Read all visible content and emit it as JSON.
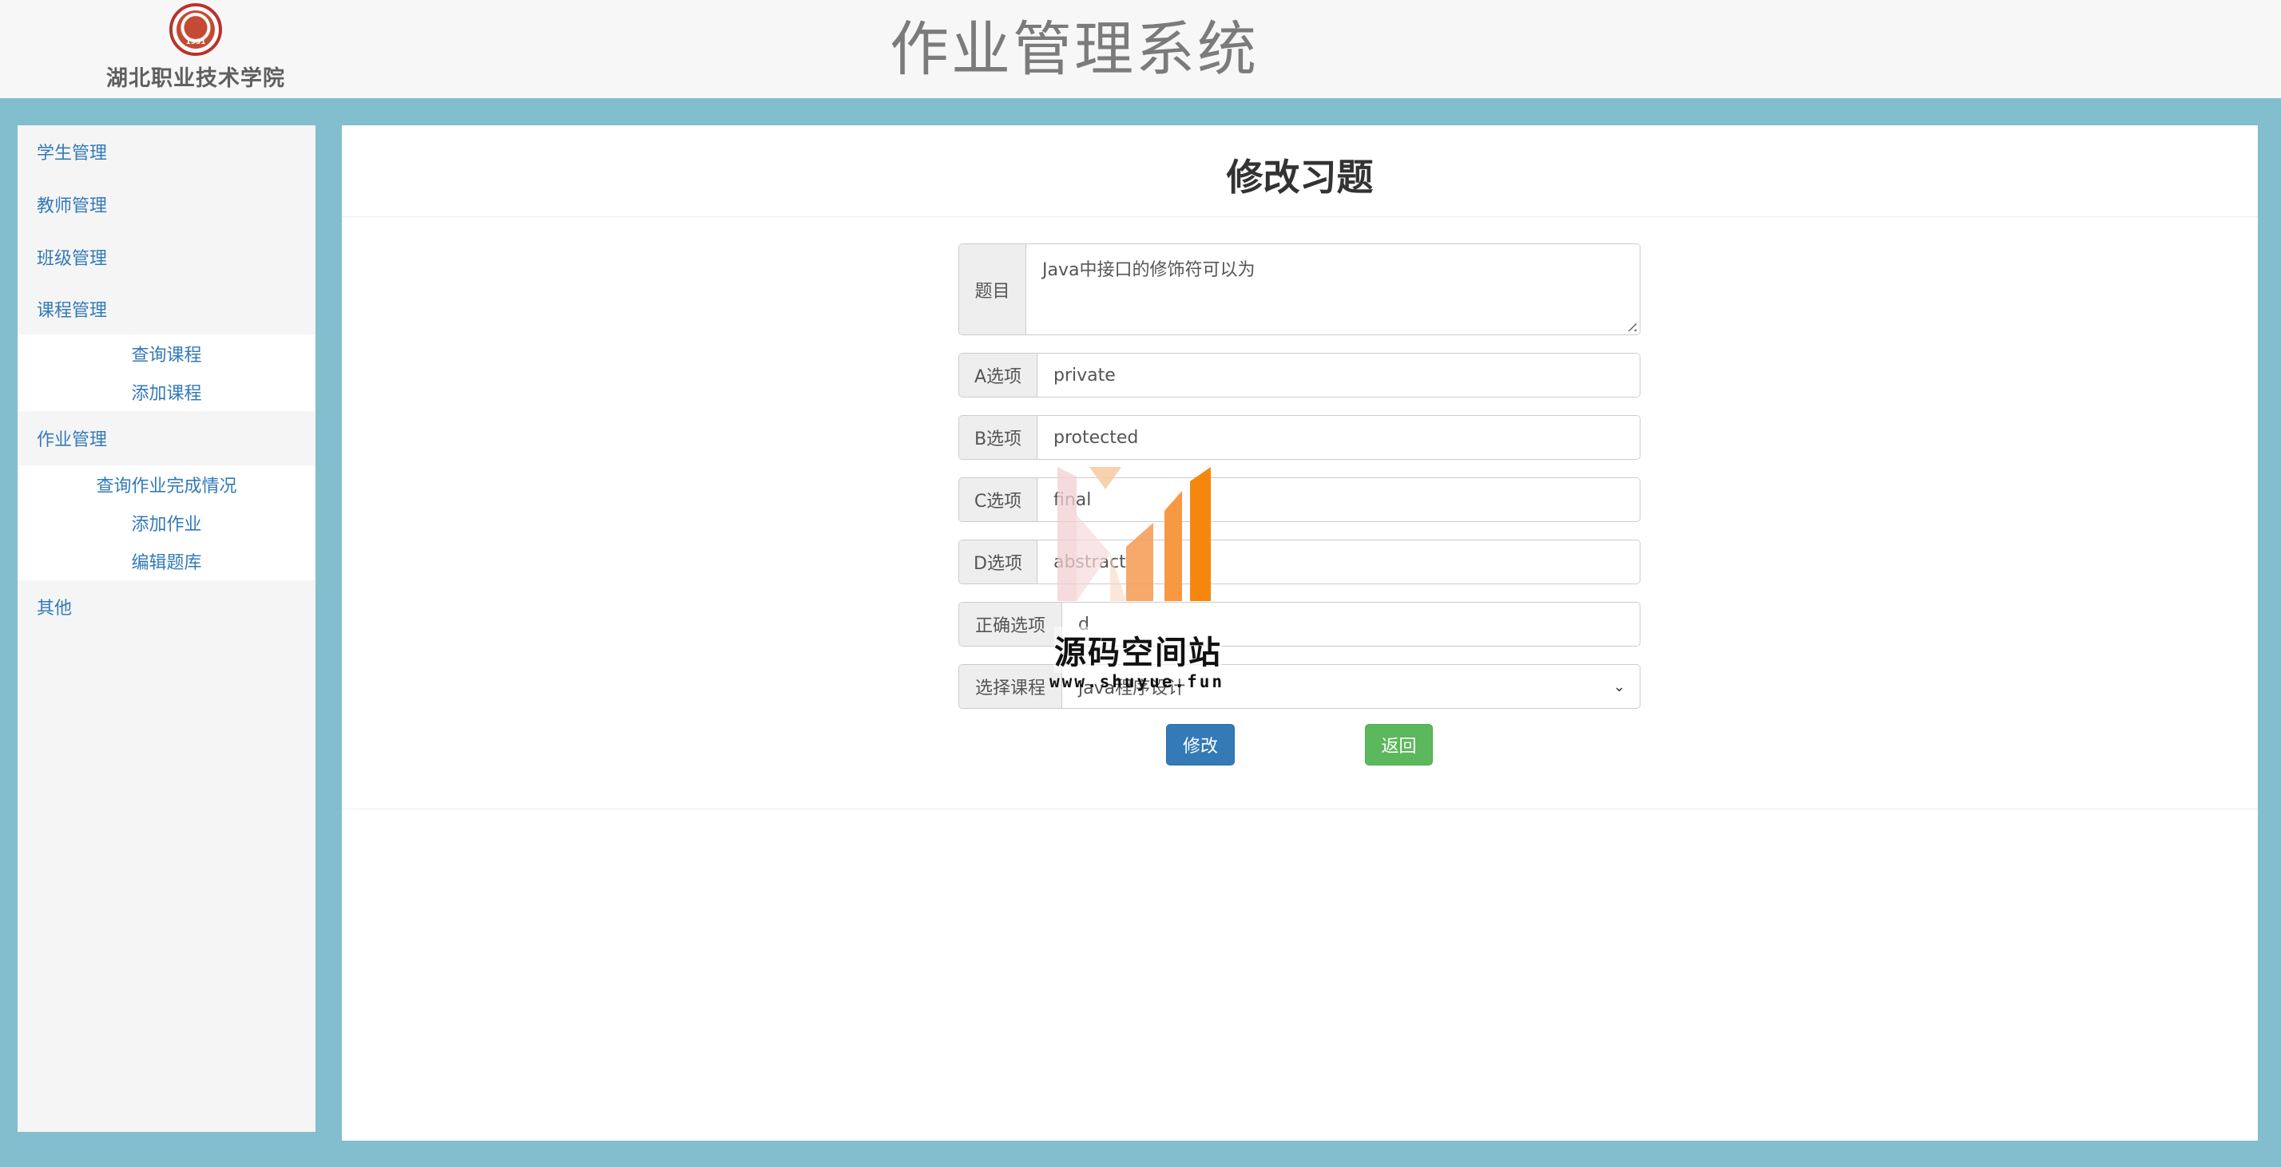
{
  "header": {
    "school_name": "湖北职业技术学院",
    "seal_year": "1931",
    "system_title": "作业管理系统"
  },
  "sidebar": {
    "groups": [
      {
        "label": "学生管理",
        "items": []
      },
      {
        "label": "教师管理",
        "items": []
      },
      {
        "label": "班级管理",
        "items": []
      },
      {
        "label": "课程管理",
        "items": [
          "查询课程",
          "添加课程"
        ]
      },
      {
        "label": "作业管理",
        "items": [
          "查询作业完成情况",
          "添加作业",
          "编辑题库"
        ]
      },
      {
        "label": "其他",
        "items": []
      }
    ]
  },
  "main": {
    "title": "修改习题",
    "form": {
      "question_label": "题目",
      "question_value": "Java中接口的修饰符可以为",
      "option_a_label": "A选项",
      "option_a_value": "private",
      "option_b_label": "B选项",
      "option_b_value": "protected",
      "option_c_label": "C选项",
      "option_c_value": "final",
      "option_d_label": "D选项",
      "option_d_value": "abstract",
      "answer_label": "正确选项",
      "answer_value": "d",
      "course_label": "选择课程",
      "course_value": "java程序设计"
    },
    "buttons": {
      "edit": "修改",
      "back": "返回"
    }
  },
  "watermark": {
    "title": "源码空间站",
    "url": "www.shuyue.fun"
  },
  "colors": {
    "page_background": "#82bece",
    "link_blue": "#337ab7",
    "primary_button": "#337ab7",
    "success_button": "#5cb85c",
    "seal_red": "#b8332c"
  }
}
